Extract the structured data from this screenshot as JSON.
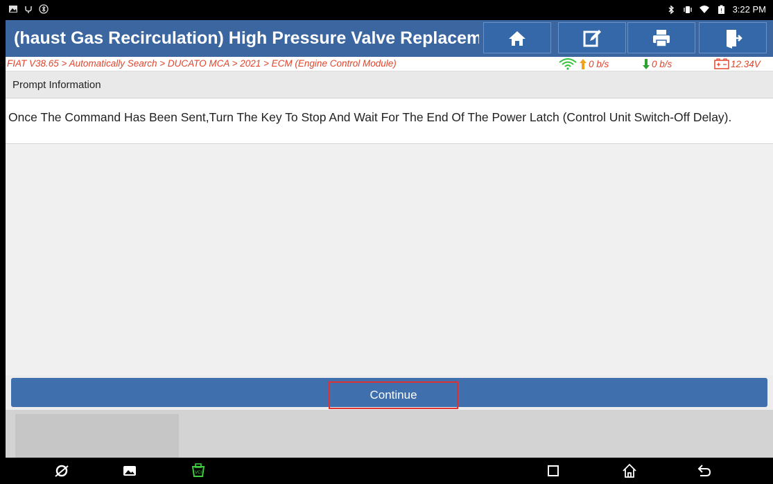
{
  "status_bar": {
    "time": "3:22 PM",
    "left_icons": [
      "image-notification-icon",
      "usb-icon",
      "bluetooth-settings-icon"
    ],
    "right_icons": [
      "bluetooth-icon",
      "vibrate-icon",
      "wifi-icon",
      "battery-icon"
    ]
  },
  "title_bar": {
    "title": "(haust Gas Recirculation) High Pressure Valve Replacem",
    "buttons": [
      "home-icon",
      "edit-icon",
      "print-icon",
      "exit-icon"
    ]
  },
  "breadcrumb": {
    "path": "FIAT V38.65 > Automatically Search > DUCATO MCA > 2021 > ECM (Engine Control Module)",
    "upload_rate": "0 b/s",
    "download_rate": "0 b/s",
    "voltage": "12.34V"
  },
  "prompt": {
    "header": "Prompt Information",
    "message": "Once The Command Has Been Sent,Turn The Key To Stop And Wait For The End Of The Power Latch (Control Unit Switch-Off Delay)."
  },
  "actions": {
    "continue_label": "Continue"
  },
  "colors": {
    "title_bar": "#3b66a0",
    "breadcrumb_text": "#e0452c",
    "continue_button": "#3f6fad",
    "highlight_border": "#e03030",
    "wifi_green": "#36c13a",
    "arrow_orange": "#f2a11f",
    "arrow_green": "#2fa12f"
  },
  "nav_bar": {
    "icons": [
      "browser-icon",
      "gallery-icon",
      "vci-icon",
      "recent-apps-icon",
      "home-nav-icon",
      "back-icon"
    ]
  }
}
